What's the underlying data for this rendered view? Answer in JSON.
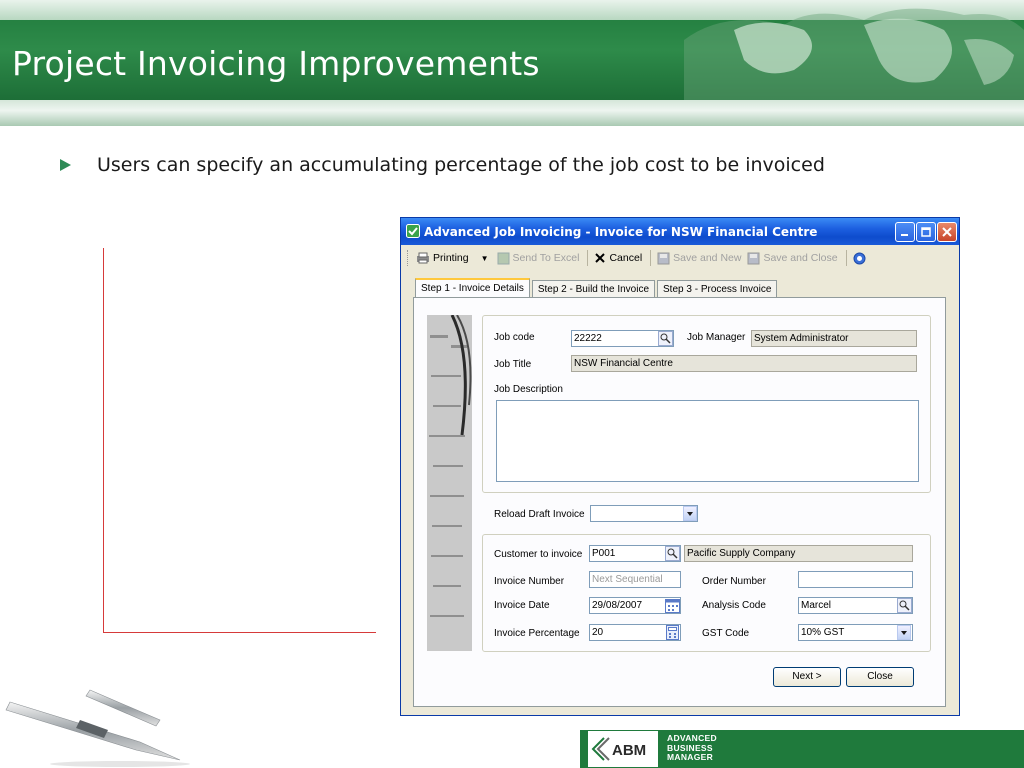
{
  "slide": {
    "title": "Project Invoicing Improvements",
    "bullet": "Users can specify an accumulating percentage of the job cost to be invoiced",
    "footer_lines": [
      "ADVANCED",
      "BUSINESS",
      "MANAGER"
    ],
    "logo_text": "ABM"
  },
  "window": {
    "title": "Advanced Job Invoicing - Invoice for NSW Financial Centre",
    "toolbar": {
      "printing": "Printing",
      "send_to_excel": "Send To Excel",
      "cancel": "Cancel",
      "save_and_new": "Save and New",
      "save_and_close": "Save and Close"
    },
    "tabs": [
      "Step 1 - Invoice Details",
      "Step 2 - Build the Invoice",
      "Step 3 - Process Invoice"
    ],
    "job": {
      "job_code_label": "Job code",
      "job_code": "22222",
      "job_manager_label": "Job Manager",
      "job_manager": "System Administrator",
      "job_title_label": "Job Title",
      "job_title": "NSW Financial Centre",
      "job_description_label": "Job Description",
      "job_description": ""
    },
    "reload_draft_label": "Reload Draft Invoice",
    "reload_draft_value": "",
    "invoice": {
      "customer_label": "Customer to invoice",
      "customer_code": "P001",
      "customer_name": "Pacific Supply Company",
      "invoice_number_label": "Invoice Number",
      "invoice_number_placeholder": "Next Sequential",
      "order_number_label": "Order Number",
      "order_number": "",
      "invoice_date_label": "Invoice Date",
      "invoice_date": "29/08/2007",
      "analysis_code_label": "Analysis Code",
      "analysis_code": "Marcel",
      "invoice_percentage_label": "Invoice Percentage",
      "invoice_percentage": "20",
      "gst_code_label": "GST Code",
      "gst_code": "10% GST"
    },
    "buttons": {
      "next": "Next >",
      "close": "Close"
    }
  },
  "colors": {
    "header_green": "#1f7a3c",
    "xp_blue": "#0e4ccd",
    "red_line": "#d63a3a"
  }
}
